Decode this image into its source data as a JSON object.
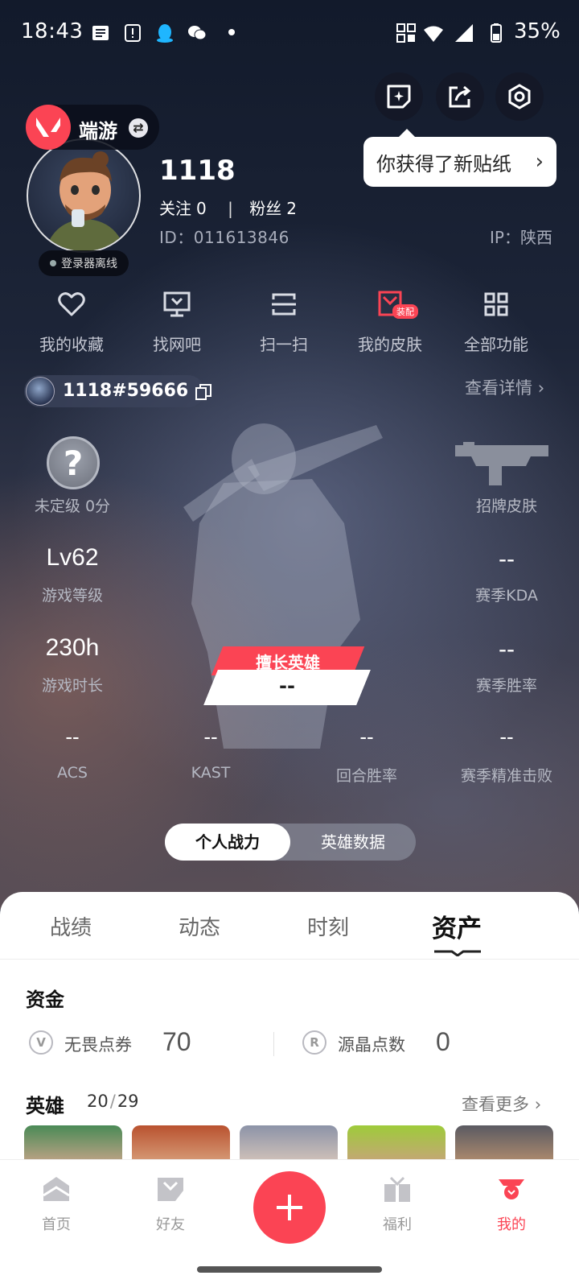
{
  "status_bar": {
    "time": "18:43",
    "battery": "35%"
  },
  "tooltip": {
    "text": "你获得了新贴纸"
  },
  "profile": {
    "game_name": "端游",
    "status": "登录器离线",
    "username": "1118",
    "follow_label": "关注",
    "follow_count": "0",
    "fans_label": "粉丝",
    "fans_count": "2",
    "id": "ID：011613846",
    "ip": "IP：陕西"
  },
  "quick_actions": [
    {
      "label": "我的收藏",
      "icon": "heart-icon"
    },
    {
      "label": "找网吧",
      "icon": "monitor-icon"
    },
    {
      "label": "扫一扫",
      "icon": "scan-icon"
    },
    {
      "label": "我的皮肤",
      "icon": "skin-icon",
      "badge": "装配"
    },
    {
      "label": "全部功能",
      "icon": "grid-icon"
    }
  ],
  "riot_id": {
    "text": "1118#59666",
    "view_detail": "查看详情"
  },
  "stats": {
    "rank": {
      "value": "未定级 0分"
    },
    "skin": {
      "label": "招牌皮肤"
    },
    "level": {
      "value": "Lv62",
      "label": "游戏等级"
    },
    "kda": {
      "value": "--",
      "label": "赛季KDA"
    },
    "playtime": {
      "value": "230h",
      "label": "游戏时长"
    },
    "winrate": {
      "value": "--",
      "label": "赛季胜率"
    },
    "best_hero": {
      "label": "擅长英雄",
      "value": "--"
    },
    "acs": {
      "value": "--",
      "label": "ACS"
    },
    "kast": {
      "value": "--",
      "label": "KAST"
    },
    "round_win": {
      "value": "--",
      "label": "回合胜率"
    },
    "headshot": {
      "value": "--",
      "label": "赛季精准击败"
    }
  },
  "segmented": {
    "active": "个人战力",
    "inactive": "英雄数据"
  },
  "tabs": [
    "战绩",
    "动态",
    "时刻",
    "资产"
  ],
  "assets": {
    "funds_title": "资金",
    "vp_label": "无畏点券",
    "vp_value": "70",
    "rp_label": "源晶点数",
    "rp_value": "0",
    "heroes_title": "英雄",
    "heroes_owned": "20",
    "heroes_total": "29",
    "see_more": "查看更多"
  },
  "bottom_nav": [
    {
      "label": "首页",
      "icon": "home-icon"
    },
    {
      "label": "好友",
      "icon": "friends-icon"
    },
    {
      "label": "福利",
      "icon": "gift-icon"
    },
    {
      "label": "我的",
      "icon": "profile-icon"
    }
  ],
  "colors": {
    "accent": "#fb4454",
    "tab_active": "#111111"
  }
}
